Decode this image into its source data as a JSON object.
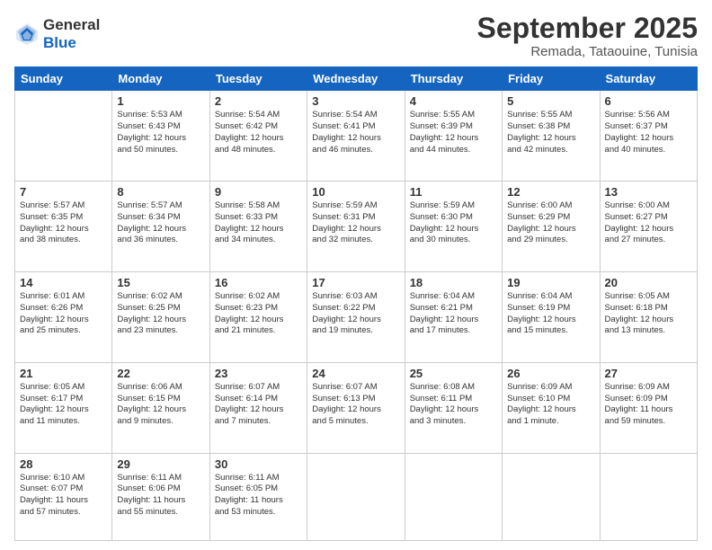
{
  "header": {
    "logo_line1": "General",
    "logo_line2": "Blue",
    "month": "September 2025",
    "location": "Remada, Tataouine, Tunisia"
  },
  "weekdays": [
    "Sunday",
    "Monday",
    "Tuesday",
    "Wednesday",
    "Thursday",
    "Friday",
    "Saturday"
  ],
  "weeks": [
    [
      {
        "day": "",
        "info": ""
      },
      {
        "day": "1",
        "info": "Sunrise: 5:53 AM\nSunset: 6:43 PM\nDaylight: 12 hours\nand 50 minutes."
      },
      {
        "day": "2",
        "info": "Sunrise: 5:54 AM\nSunset: 6:42 PM\nDaylight: 12 hours\nand 48 minutes."
      },
      {
        "day": "3",
        "info": "Sunrise: 5:54 AM\nSunset: 6:41 PM\nDaylight: 12 hours\nand 46 minutes."
      },
      {
        "day": "4",
        "info": "Sunrise: 5:55 AM\nSunset: 6:39 PM\nDaylight: 12 hours\nand 44 minutes."
      },
      {
        "day": "5",
        "info": "Sunrise: 5:55 AM\nSunset: 6:38 PM\nDaylight: 12 hours\nand 42 minutes."
      },
      {
        "day": "6",
        "info": "Sunrise: 5:56 AM\nSunset: 6:37 PM\nDaylight: 12 hours\nand 40 minutes."
      }
    ],
    [
      {
        "day": "7",
        "info": "Sunrise: 5:57 AM\nSunset: 6:35 PM\nDaylight: 12 hours\nand 38 minutes."
      },
      {
        "day": "8",
        "info": "Sunrise: 5:57 AM\nSunset: 6:34 PM\nDaylight: 12 hours\nand 36 minutes."
      },
      {
        "day": "9",
        "info": "Sunrise: 5:58 AM\nSunset: 6:33 PM\nDaylight: 12 hours\nand 34 minutes."
      },
      {
        "day": "10",
        "info": "Sunrise: 5:59 AM\nSunset: 6:31 PM\nDaylight: 12 hours\nand 32 minutes."
      },
      {
        "day": "11",
        "info": "Sunrise: 5:59 AM\nSunset: 6:30 PM\nDaylight: 12 hours\nand 30 minutes."
      },
      {
        "day": "12",
        "info": "Sunrise: 6:00 AM\nSunset: 6:29 PM\nDaylight: 12 hours\nand 29 minutes."
      },
      {
        "day": "13",
        "info": "Sunrise: 6:00 AM\nSunset: 6:27 PM\nDaylight: 12 hours\nand 27 minutes."
      }
    ],
    [
      {
        "day": "14",
        "info": "Sunrise: 6:01 AM\nSunset: 6:26 PM\nDaylight: 12 hours\nand 25 minutes."
      },
      {
        "day": "15",
        "info": "Sunrise: 6:02 AM\nSunset: 6:25 PM\nDaylight: 12 hours\nand 23 minutes."
      },
      {
        "day": "16",
        "info": "Sunrise: 6:02 AM\nSunset: 6:23 PM\nDaylight: 12 hours\nand 21 minutes."
      },
      {
        "day": "17",
        "info": "Sunrise: 6:03 AM\nSunset: 6:22 PM\nDaylight: 12 hours\nand 19 minutes."
      },
      {
        "day": "18",
        "info": "Sunrise: 6:04 AM\nSunset: 6:21 PM\nDaylight: 12 hours\nand 17 minutes."
      },
      {
        "day": "19",
        "info": "Sunrise: 6:04 AM\nSunset: 6:19 PM\nDaylight: 12 hours\nand 15 minutes."
      },
      {
        "day": "20",
        "info": "Sunrise: 6:05 AM\nSunset: 6:18 PM\nDaylight: 12 hours\nand 13 minutes."
      }
    ],
    [
      {
        "day": "21",
        "info": "Sunrise: 6:05 AM\nSunset: 6:17 PM\nDaylight: 12 hours\nand 11 minutes."
      },
      {
        "day": "22",
        "info": "Sunrise: 6:06 AM\nSunset: 6:15 PM\nDaylight: 12 hours\nand 9 minutes."
      },
      {
        "day": "23",
        "info": "Sunrise: 6:07 AM\nSunset: 6:14 PM\nDaylight: 12 hours\nand 7 minutes."
      },
      {
        "day": "24",
        "info": "Sunrise: 6:07 AM\nSunset: 6:13 PM\nDaylight: 12 hours\nand 5 minutes."
      },
      {
        "day": "25",
        "info": "Sunrise: 6:08 AM\nSunset: 6:11 PM\nDaylight: 12 hours\nand 3 minutes."
      },
      {
        "day": "26",
        "info": "Sunrise: 6:09 AM\nSunset: 6:10 PM\nDaylight: 12 hours\nand 1 minute."
      },
      {
        "day": "27",
        "info": "Sunrise: 6:09 AM\nSunset: 6:09 PM\nDaylight: 11 hours\nand 59 minutes."
      }
    ],
    [
      {
        "day": "28",
        "info": "Sunrise: 6:10 AM\nSunset: 6:07 PM\nDaylight: 11 hours\nand 57 minutes."
      },
      {
        "day": "29",
        "info": "Sunrise: 6:11 AM\nSunset: 6:06 PM\nDaylight: 11 hours\nand 55 minutes."
      },
      {
        "day": "30",
        "info": "Sunrise: 6:11 AM\nSunset: 6:05 PM\nDaylight: 11 hours\nand 53 minutes."
      },
      {
        "day": "",
        "info": ""
      },
      {
        "day": "",
        "info": ""
      },
      {
        "day": "",
        "info": ""
      },
      {
        "day": "",
        "info": ""
      }
    ]
  ]
}
